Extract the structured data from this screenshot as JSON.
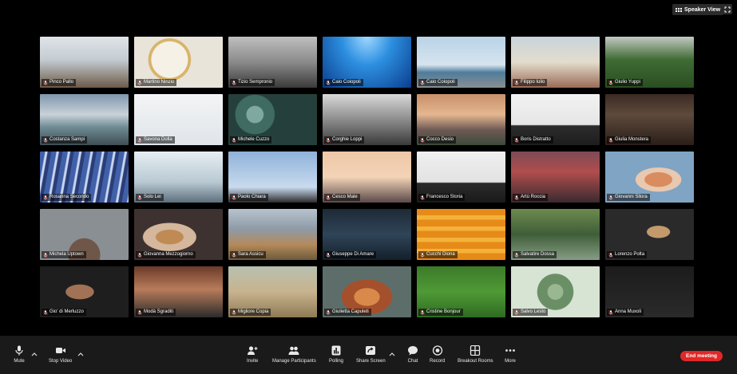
{
  "topbar": {
    "speaker_view_label": "Speaker View"
  },
  "participants": [
    {
      "name": "Pinco Pallo",
      "scene": "misty mountain trees"
    },
    {
      "name": "Martino Ninzio",
      "scene": "clock close-up"
    },
    {
      "name": "Tizio Sempronio",
      "scene": "grey mountain lake"
    },
    {
      "name": "Caio Coiopoli",
      "scene": "underwater blue"
    },
    {
      "name": "Caio Coiopoli",
      "scene": "seaside tower"
    },
    {
      "name": "Filippo Iulio",
      "scene": "coastal town"
    },
    {
      "name": "Giulio Yuppi",
      "scene": "green hills waterfall"
    },
    {
      "name": "Costanza Sampi",
      "scene": "waterfall landscape"
    },
    {
      "name": "Savona Dolla",
      "scene": "white foggy"
    },
    {
      "name": "Michele Cuzzo",
      "scene": "succulents"
    },
    {
      "name": "Corghie Loppi",
      "scene": "lighthouse black and white"
    },
    {
      "name": "Cocco Desio",
      "scene": "sunset mountains"
    },
    {
      "name": "Boris Distratto",
      "scene": "typewriter white"
    },
    {
      "name": "Giulia Monstera",
      "scene": "train station"
    },
    {
      "name": "Rosanna Secondo",
      "scene": "stage lights"
    },
    {
      "name": "Solo Lei",
      "scene": "snowy mountains"
    },
    {
      "name": "Paolo Chiara",
      "scene": "blue sky silhouette"
    },
    {
      "name": "Cesco Male",
      "scene": "peach sky"
    },
    {
      "name": "Francesco Storia",
      "scene": "typewriter"
    },
    {
      "name": "Artù Roccia",
      "scene": "red bridge"
    },
    {
      "name": "Giovanni Sllora",
      "scene": "red-haired girl portrait"
    },
    {
      "name": "Michela Uptown",
      "scene": "grey portrait"
    },
    {
      "name": "Giovanna Mezzogiorno",
      "scene": "woman portrait warm"
    },
    {
      "name": "Sara Assicu",
      "scene": "hiker mountains"
    },
    {
      "name": "Giuseppe Di Amare",
      "scene": "man in suit"
    },
    {
      "name": "Cucchi Diona",
      "scene": "orange wall couple"
    },
    {
      "name": "Salvatire Dossa",
      "scene": "child by pond"
    },
    {
      "name": "Lorenzo Polta",
      "scene": "bearded man dark"
    },
    {
      "name": "Gio' di Merluzzo",
      "scene": "bearded man portrait"
    },
    {
      "name": "Modà Sgraditi",
      "scene": "bodybuilders"
    },
    {
      "name": "Migliore Copia",
      "scene": "woman in field"
    },
    {
      "name": "Giulietta Capuleti",
      "scene": "canyon"
    },
    {
      "name": "Cristine Bonjour",
      "scene": "green field person lying"
    },
    {
      "name": "Salvo Lesto",
      "scene": "green leaves"
    },
    {
      "name": "Anna Muxoli",
      "scene": "dark room lamp"
    }
  ],
  "toolbar": {
    "mute": "Mute",
    "stop_video": "Stop Video",
    "invite": "Invite",
    "manage_participants": "Manage Participants",
    "polling": "Polling",
    "share_screen": "Share Screen",
    "chat": "Chat",
    "record": "Record",
    "breakout_rooms": "Breakout Rooms",
    "more": "More",
    "end_meeting": "End meeting"
  },
  "colors": {
    "end_button": "#e02828",
    "toolbar_bg": "#1a1a1a",
    "background": "#000000"
  }
}
